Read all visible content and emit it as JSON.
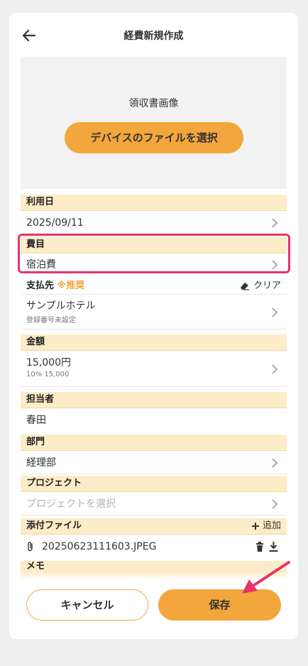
{
  "header": {
    "title": "経費新規作成"
  },
  "receipt": {
    "label": "領収書画像",
    "button_label": "デバイスのファイルを選択"
  },
  "fields": {
    "date": {
      "label": "利用日",
      "value": "2025/09/11"
    },
    "category": {
      "label": "費目",
      "value": "宿泊費"
    },
    "payee": {
      "label": "支払先",
      "recommend": "※推奨",
      "clear_label": "クリア",
      "value": "サンプルホテル",
      "sub": "登録番号未設定"
    },
    "amount": {
      "label": "金額",
      "value": "15,000円",
      "sub": "10% 15,000"
    },
    "person": {
      "label": "担当者",
      "value": "春田"
    },
    "department": {
      "label": "部門",
      "value": "経理部"
    },
    "project": {
      "label": "プロジェクト",
      "placeholder": "プロジェクトを選択"
    },
    "attachment": {
      "label": "添付ファイル",
      "add_label": "追加",
      "file_name": "20250623111603.JPEG"
    },
    "memo": {
      "label": "メモ"
    }
  },
  "footer": {
    "cancel_label": "キャンセル",
    "save_label": "保存"
  },
  "colors": {
    "accent": "#f2a63c",
    "section_bg": "#fdecc8",
    "highlight": "#e8336a"
  },
  "icons": [
    "back-arrow-icon",
    "chevron-right-icon",
    "eraser-icon",
    "plus-icon",
    "paperclip-icon",
    "trash-icon",
    "download-icon",
    "annotation-arrow"
  ]
}
